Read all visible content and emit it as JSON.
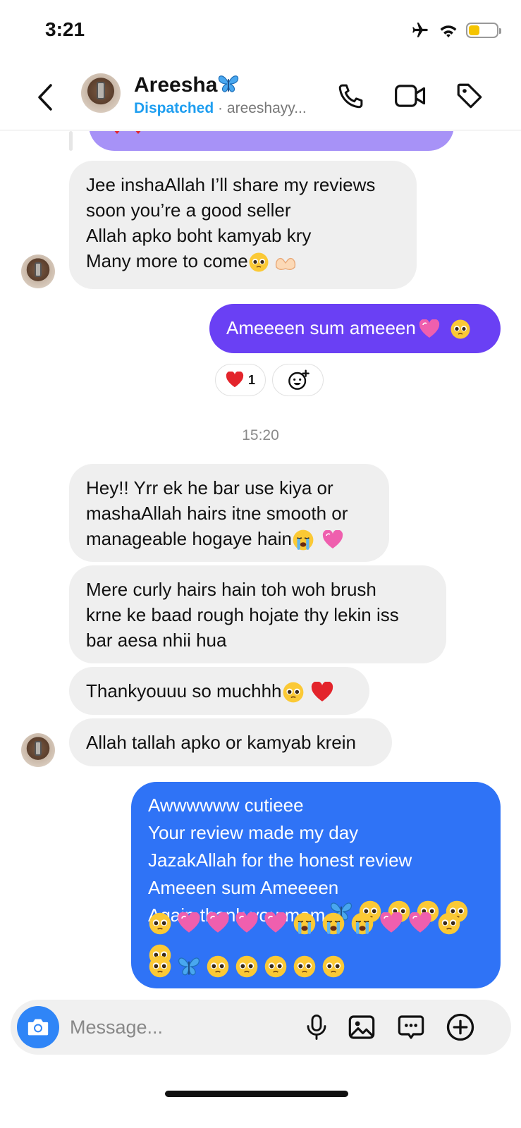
{
  "status_bar": {
    "time": "3:21",
    "battery_level": 0.35,
    "battery_color": "#f5c400"
  },
  "header": {
    "back_icon": "chevron-left-icon",
    "contact_name": "Areesha",
    "name_emoji": "butterfly",
    "status": "Dispatched",
    "separator": "·",
    "handle": "areeshayy...",
    "actions": [
      "phone-icon",
      "video-camera-icon",
      "tag-icon"
    ]
  },
  "chat": {
    "messages": [
      {
        "id": "m1",
        "type": "received",
        "lines": [
          "Jee inshaAllah I’ll share my reviews",
          "soon you’re a good seller",
          "Allah apko boht kamyab kry",
          "Many more to come"
        ],
        "trailing_emojis": [
          "pleading-face",
          "heart-hands"
        ]
      },
      {
        "id": "m2",
        "type": "sent",
        "text": "Ameeeen sum ameeen",
        "trailing_emojis": [
          "pink-heart",
          "pleading-face"
        ]
      },
      {
        "id": "m3",
        "type": "received",
        "lines": [
          "Hey!! Yrr ek he bar use kiya or",
          "mashaAllah hairs itne smooth or",
          "manageable hogaye hain"
        ],
        "trailing_emojis": [
          "crying-face",
          "pink-heart"
        ]
      },
      {
        "id": "m4",
        "type": "received",
        "lines": [
          "Mere curly hairs hain toh woh brush",
          "krne ke baad rough hojate thy lekin iss",
          "bar aesa nhii hua"
        ]
      },
      {
        "id": "m5",
        "type": "received",
        "text": "Thankyouuu so muchhh",
        "trailing_emojis": [
          "pleading-face",
          "red-heart"
        ]
      },
      {
        "id": "m6",
        "type": "received",
        "text": "Allah tallah apko or kamyab krein"
      },
      {
        "id": "m7",
        "type": "sent",
        "lines": [
          "Awwwwww cutieee",
          "Your review made my day",
          "JazakAllah for the honest review",
          "Ameeen sum Ameeeen",
          "Again thank you mam"
        ],
        "emoji_rows": [
          [
            "butterfly",
            "pleading-face",
            "pleading-face",
            "pleading-face",
            "pleading-face"
          ],
          [
            "pleading-face",
            "pink-heart",
            "pink-heart",
            "pink-heart",
            "pink-heart",
            "crying-face",
            "crying-face",
            "crying-face",
            "pink-heart",
            "pink-heart",
            "pleading-face",
            "pleading-face"
          ],
          [
            "pleading-face",
            "butterfly",
            "pleading-face",
            "pleading-face",
            "pleading-face",
            "pleading-face",
            "pleading-face"
          ]
        ]
      }
    ],
    "reaction": {
      "emoji": "red-heart",
      "count": "1"
    },
    "add_reaction_icon": "add-reaction-icon",
    "timestamp": "15:20"
  },
  "composer": {
    "camera_icon": "camera-icon",
    "placeholder": "Message...",
    "actions": [
      "microphone-icon",
      "image-icon",
      "sticker-icon",
      "plus-circle-icon"
    ]
  },
  "colors": {
    "sent_purple": "#6a40f4",
    "sent_blue": "#2f73f6",
    "received_bubble": "#efefef",
    "status_blue": "#1e9ef0",
    "camera_blue": "#2f85f7"
  }
}
